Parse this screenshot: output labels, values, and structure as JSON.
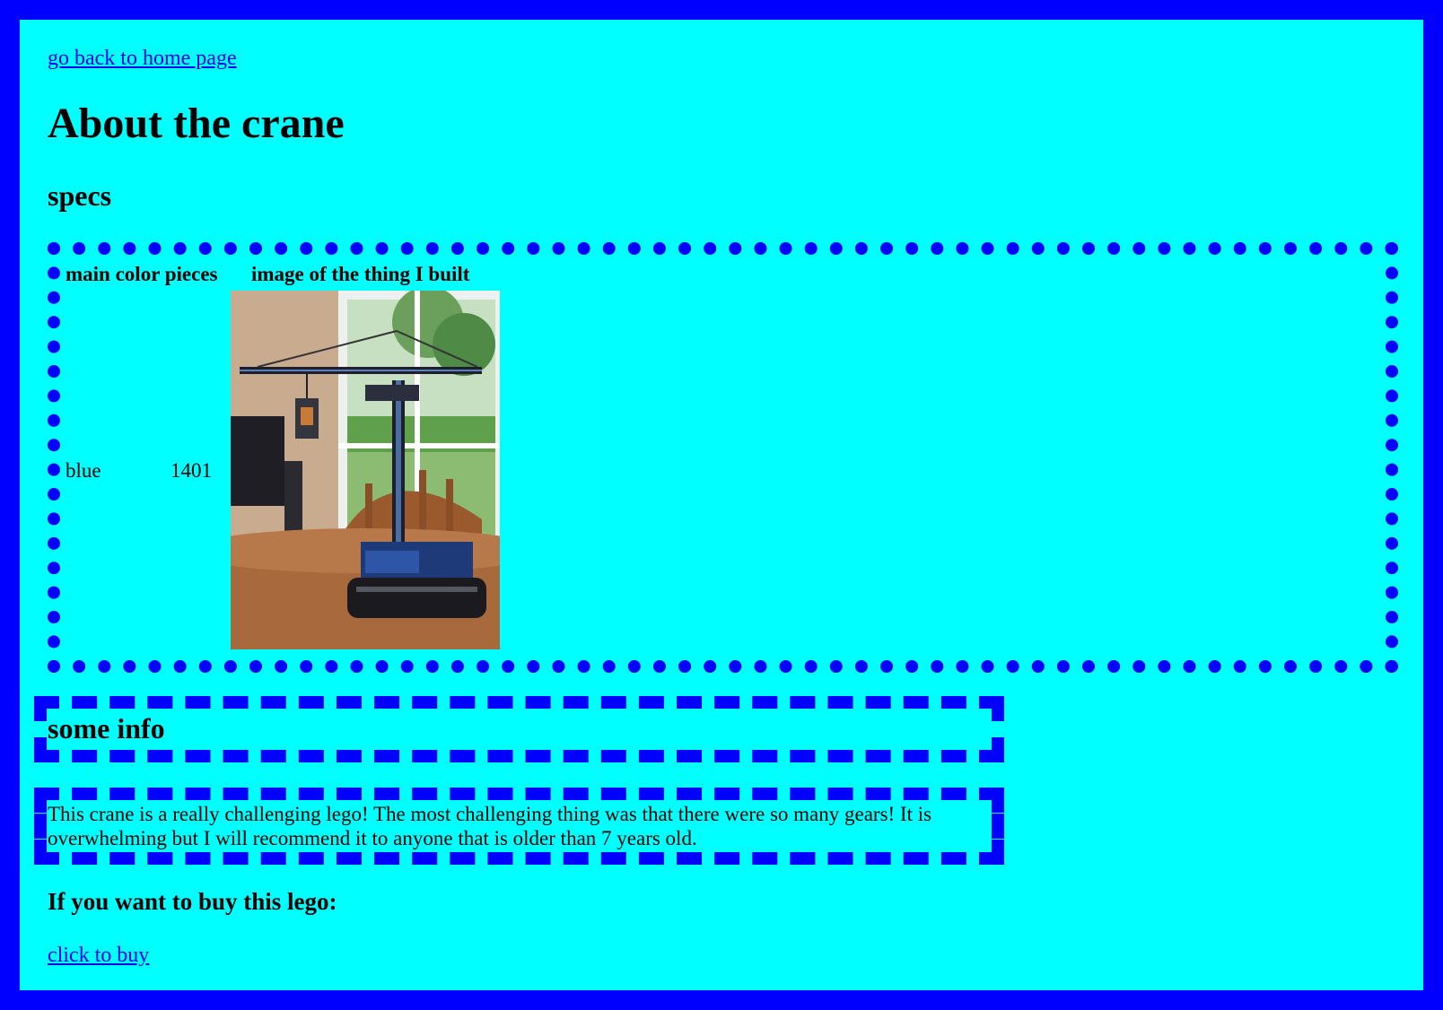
{
  "nav": {
    "home_link": "go back to home page"
  },
  "page": {
    "title": "About the crane"
  },
  "specs": {
    "heading": "specs",
    "headers": [
      "main color pieces",
      "image of the thing I built"
    ],
    "row": {
      "color": "blue",
      "pieces": "1401"
    },
    "image_alt": "lego crane photo"
  },
  "info": {
    "heading": "some info",
    "text": "This crane is a really challenging lego! The most challenging thing was that there were so many gears! It is overwhelming but I will recommend it to anyone that is older than 7 years old."
  },
  "buy": {
    "heading": "If you want to buy this lego:",
    "link": "click to buy"
  },
  "colors": {
    "background": "#00ffff",
    "border": "#0000ff",
    "link": "#0000ee"
  }
}
